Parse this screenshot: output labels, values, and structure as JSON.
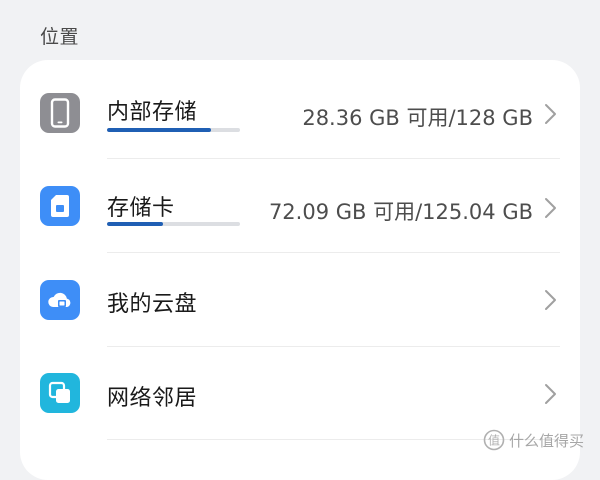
{
  "section_title": "位置",
  "items": [
    {
      "label": "内部存储",
      "value": "28.36 GB 可用/128 GB",
      "usage_fraction": 0.78,
      "icon": "phone-icon",
      "icon_color": "#8e8e93"
    },
    {
      "label": "存储卡",
      "value": "72.09 GB 可用/125.04 GB",
      "usage_fraction": 0.42,
      "icon": "sd-card-icon",
      "icon_color": "#3e8ef7"
    },
    {
      "label": "我的云盘",
      "icon": "cloud-icon",
      "icon_color": "#3e8ef7"
    },
    {
      "label": "网络邻居",
      "icon": "network-neighborhood-icon",
      "icon_color": "#21b6dd"
    }
  ],
  "watermark": "什么值得买",
  "accent_color": "#1f5fb4"
}
